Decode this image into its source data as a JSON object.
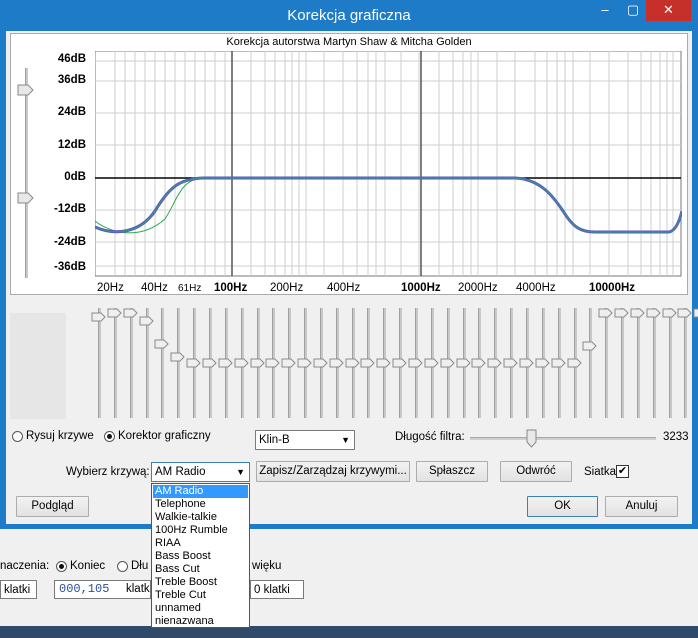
{
  "window": {
    "title": "Korekcja graficzna",
    "controls": [
      "–",
      "▢",
      "✕"
    ]
  },
  "plot": {
    "title": "Korekcja autorstwa Martyn Shaw & Mitcha Golden",
    "db_labels": [
      "46dB",
      "36dB",
      "24dB",
      "12dB",
      "0dB",
      "-12dB",
      "-24dB",
      "-36dB"
    ],
    "freq_labels": [
      {
        "text": "20Hz",
        "bold": false
      },
      {
        "text": "40Hz",
        "bold": false
      },
      {
        "text": "61Hz",
        "bold": false
      },
      {
        "text": "100Hz",
        "bold": true
      },
      {
        "text": "200Hz",
        "bold": false
      },
      {
        "text": "400Hz",
        "bold": false
      },
      {
        "text": "1000Hz",
        "bold": true
      },
      {
        "text": "2000Hz",
        "bold": false
      },
      {
        "text": "4000Hz",
        "bold": false
      },
      {
        "text": "10000Hz",
        "bold": true
      }
    ]
  },
  "mode": {
    "draw_label": "Rysuj krzywe",
    "graphic_label": "Korektor graficzny",
    "selected": "graphic"
  },
  "interpolation": {
    "value": "Klin-B"
  },
  "filter": {
    "label": "Długość filtra:",
    "value": "3233",
    "fraction": 0.33
  },
  "curve": {
    "label": "Wybierz krzywą:",
    "value": "AM Radio",
    "options": [
      "AM Radio",
      "Telephone",
      "Walkie-talkie",
      "100Hz Rumble",
      "RIAA",
      "Bass Boost",
      "Bass Cut",
      "Treble Boost",
      "Treble Cut",
      "unnamed",
      "nienazwana"
    ]
  },
  "buttons": {
    "save_manage": "Zapisz/Zarządzaj krzywymi...",
    "flatten": "Spłaszcz",
    "invert": "Odwróć",
    "grid_label": "Siatka",
    "grid_checked": true,
    "preview": "Podgląd",
    "ok": "OK",
    "cancel": "Anuluj"
  },
  "background_app": {
    "label_1": "naczenia:",
    "radio_end": "Koniec",
    "radio_len": "Dłu",
    "sound_suffix": "więku",
    "unit_left": "klatki",
    "time_value": "000,105",
    "unit_mid": "klatk",
    "unit_right": "0  klatki"
  },
  "sliders": {
    "levels": [
      -22,
      -24,
      -24,
      -20,
      -9,
      -3,
      0,
      0,
      0,
      0,
      0,
      0,
      0,
      0,
      0,
      0,
      0,
      0,
      0,
      0,
      0,
      0,
      0,
      0,
      0,
      0,
      0,
      0,
      0,
      0,
      0,
      -8,
      -24,
      -24,
      -24,
      -24,
      -24,
      -24,
      -24
    ]
  },
  "colors": {
    "titlebar": "#1e7bc7",
    "close": "#c7302a",
    "curve": "#6a6ab8",
    "curve2": "#3c8f9a",
    "green": "#2aa84a"
  }
}
